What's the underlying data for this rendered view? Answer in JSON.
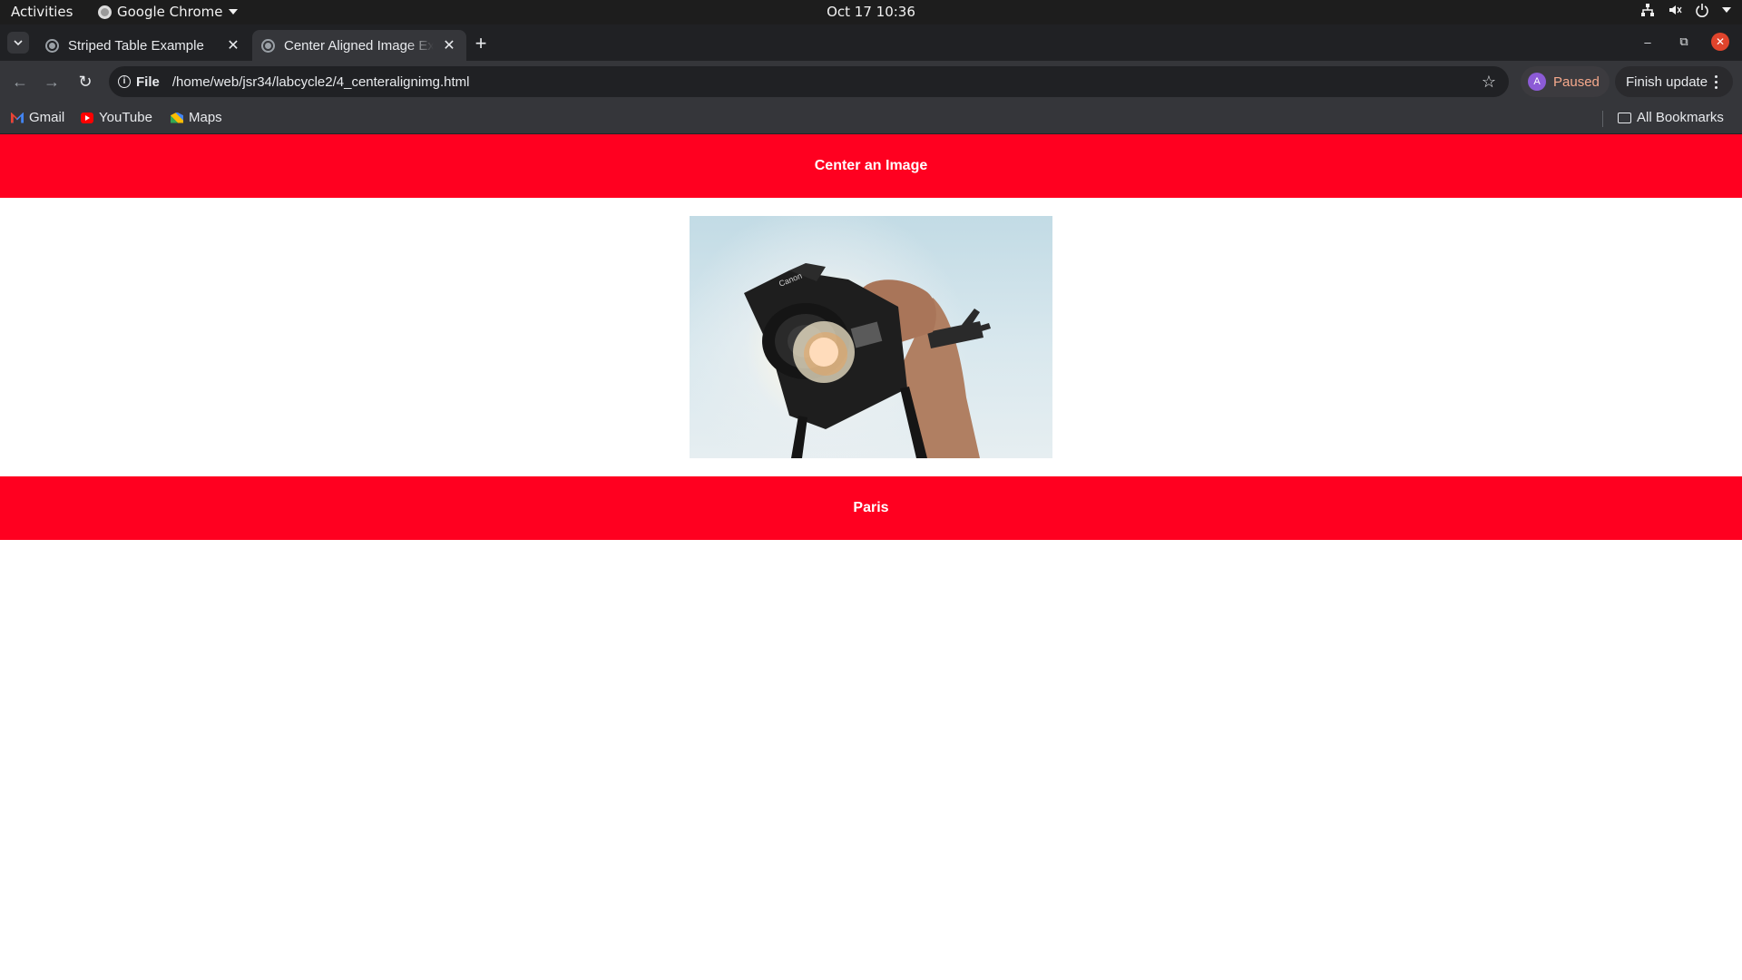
{
  "system_bar": {
    "activities": "Activities",
    "app_name": "Google Chrome",
    "clock": "Oct 17  10:36"
  },
  "tabs": [
    {
      "title": "Striped Table Example",
      "active": false
    },
    {
      "title": "Center Aligned Image Ex",
      "active": true
    }
  ],
  "toolbar": {
    "site_label": "File",
    "url": "/home/web/jsr34/labcycle2/4_centeralignimg.html",
    "profile_initial": "A",
    "profile_status": "Paused",
    "update_label": "Finish update"
  },
  "bookmarks": [
    {
      "label": "Gmail",
      "icon": "gmail-icon"
    },
    {
      "label": "YouTube",
      "icon": "youtube-icon"
    },
    {
      "label": "Maps",
      "icon": "maps-icon"
    }
  ],
  "all_bookmarks_label": "All Bookmarks",
  "page": {
    "heading": "Center an Image",
    "footer": "Paris",
    "image": "camera-photo"
  },
  "colors": {
    "banner": "#ff0020",
    "tab_active": "#35363a",
    "tab_strip": "#202124"
  }
}
